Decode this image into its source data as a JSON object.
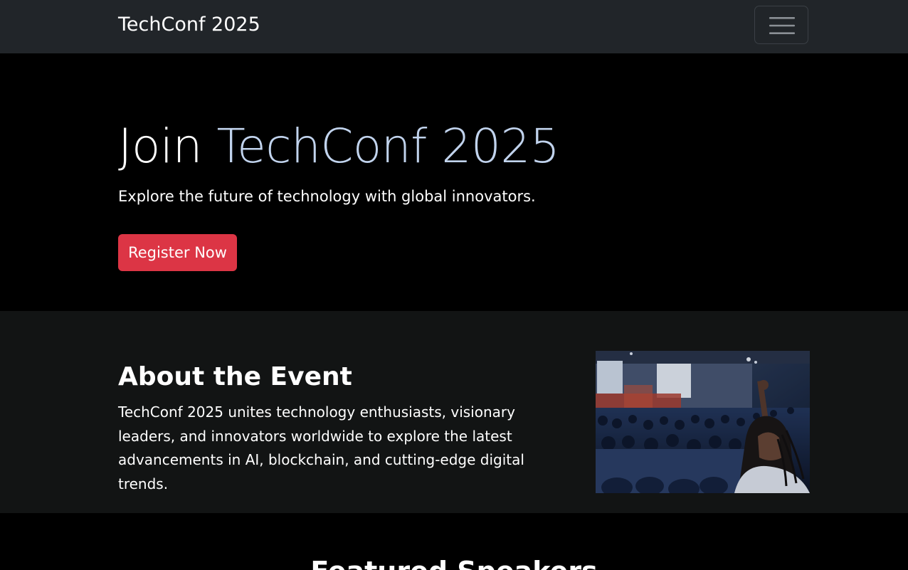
{
  "navbar": {
    "brand": "TechConf 2025",
    "toggler_icon": "hamburger-menu-icon"
  },
  "hero": {
    "title_prefix": "Join ",
    "title_accent": "TechConf 2025",
    "subtitle": "Explore the future of technology with global innovators.",
    "cta_label": "Register Now"
  },
  "about": {
    "title": "About the Event",
    "text": "TechConf 2025 unites technology enthusiasts, visionary leaders, and innovators worldwide to explore the latest advancements in AI, blockchain, and cutting-edge digital trends.",
    "image_subject": "conference-audience-photo"
  },
  "speakers": {
    "title": "Featured Speakers"
  },
  "colors": {
    "navbar_bg": "#212529",
    "hero_bg": "#000000",
    "accent_text": "#c1d3ed",
    "cta_bg": "#dc3545",
    "about_bg": "#121414"
  }
}
